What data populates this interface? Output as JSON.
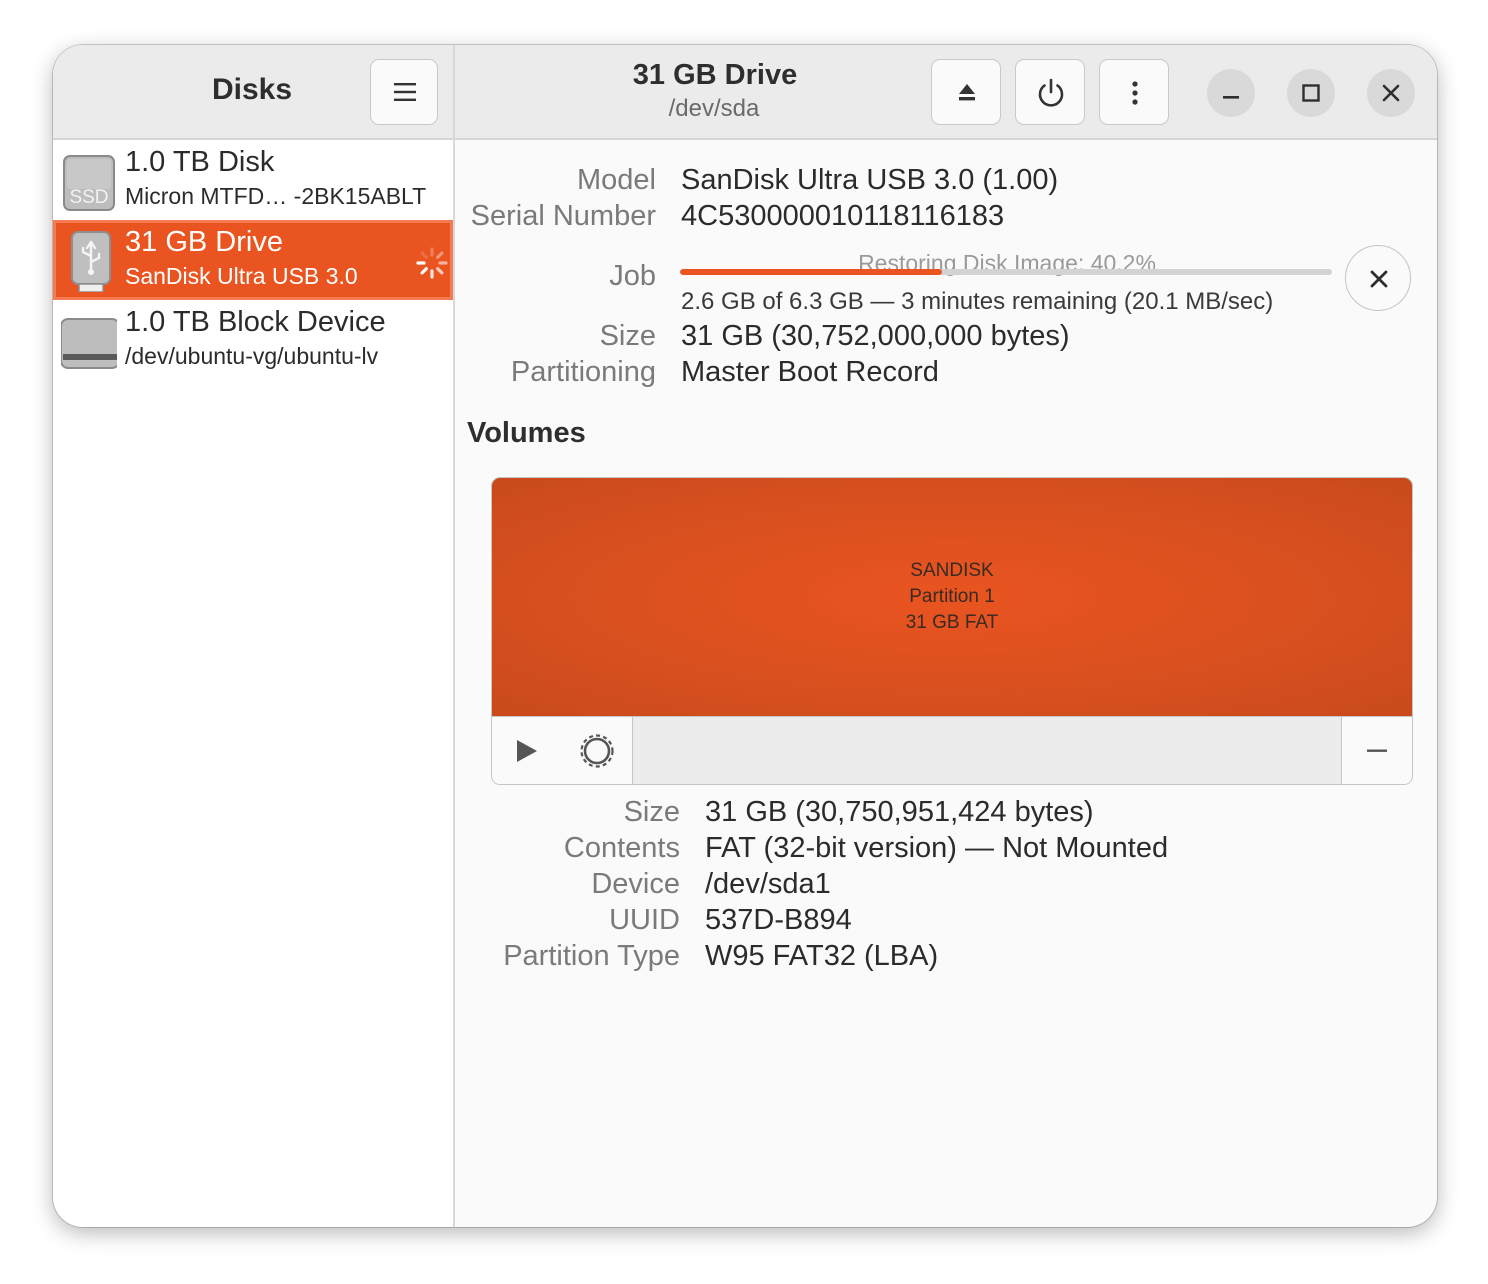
{
  "sidebar": {
    "title": "Disks",
    "menu_icon": "hamburger-menu-icon",
    "drives": [
      {
        "title": "1.0 TB Disk",
        "subtitle": "Micron MTFD… -2BK15ABLT",
        "icon": "ssd-icon",
        "icon_text": "SSD",
        "selected": false
      },
      {
        "title": "31 GB Drive",
        "subtitle": "SanDisk Ultra USB 3.0",
        "icon": "usb-drive-icon",
        "selected": true,
        "busy": true
      },
      {
        "title": "1.0 TB Block Device",
        "subtitle": "/dev/ubuntu-vg/ubuntu-lv",
        "icon": "block-device-icon",
        "selected": false
      }
    ]
  },
  "header": {
    "title": "31 GB Drive",
    "subtitle": "/dev/sda",
    "buttons": [
      "eject-icon",
      "power-icon",
      "more-options-icon"
    ],
    "window_controls": [
      "minimize-icon",
      "maximize-icon",
      "close-icon"
    ]
  },
  "drive_info": {
    "model_label": "Model",
    "model": "SanDisk Ultra USB 3.0 (1.00)",
    "serial_label": "Serial Number",
    "serial": "4C530000010118116183",
    "job_label": "Job",
    "job_title": "Restoring Disk Image: 40.2%",
    "job_progress": 0.402,
    "job_detail": "2.6 GB of 6.3 GB — 3 minutes remaining (20.1 MB/sec)",
    "size_label": "Size",
    "size": "31 GB (30,752,000,000 bytes)",
    "partitioning_label": "Partitioning",
    "partitioning": "Master Boot Record"
  },
  "volumes": {
    "heading": "Volumes",
    "partition": {
      "name": "SANDISK",
      "label": "Partition 1",
      "detail": "31 GB FAT"
    },
    "accent": "#e95420",
    "toolbar_icons": [
      "play-icon",
      "gear-icon",
      "minus-icon"
    ]
  },
  "volume_info": {
    "size_label": "Size",
    "size": "31 GB (30,750,951,424 bytes)",
    "contents_label": "Contents",
    "contents": "FAT (32-bit version) — Not Mounted",
    "device_label": "Device",
    "device": "/dev/sda1",
    "uuid_label": "UUID",
    "uuid": "537D-B894",
    "type_label": "Partition Type",
    "type": "W95 FAT32 (LBA)"
  }
}
